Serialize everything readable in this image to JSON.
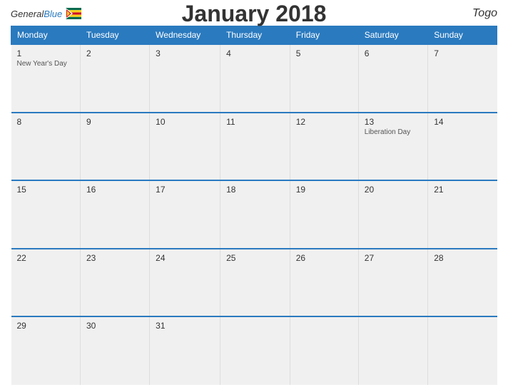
{
  "header": {
    "title": "January 2018",
    "country": "Togo",
    "logo": {
      "general": "General",
      "blue": "Blue"
    }
  },
  "weekdays": [
    "Monday",
    "Tuesday",
    "Wednesday",
    "Thursday",
    "Friday",
    "Saturday",
    "Sunday"
  ],
  "weeks": [
    [
      {
        "day": "1",
        "holiday": "New Year's Day"
      },
      {
        "day": "2",
        "holiday": ""
      },
      {
        "day": "3",
        "holiday": ""
      },
      {
        "day": "4",
        "holiday": ""
      },
      {
        "day": "5",
        "holiday": ""
      },
      {
        "day": "6",
        "holiday": ""
      },
      {
        "day": "7",
        "holiday": ""
      }
    ],
    [
      {
        "day": "8",
        "holiday": ""
      },
      {
        "day": "9",
        "holiday": ""
      },
      {
        "day": "10",
        "holiday": ""
      },
      {
        "day": "11",
        "holiday": ""
      },
      {
        "day": "12",
        "holiday": ""
      },
      {
        "day": "13",
        "holiday": "Liberation Day"
      },
      {
        "day": "14",
        "holiday": ""
      }
    ],
    [
      {
        "day": "15",
        "holiday": ""
      },
      {
        "day": "16",
        "holiday": ""
      },
      {
        "day": "17",
        "holiday": ""
      },
      {
        "day": "18",
        "holiday": ""
      },
      {
        "day": "19",
        "holiday": ""
      },
      {
        "day": "20",
        "holiday": ""
      },
      {
        "day": "21",
        "holiday": ""
      }
    ],
    [
      {
        "day": "22",
        "holiday": ""
      },
      {
        "day": "23",
        "holiday": ""
      },
      {
        "day": "24",
        "holiday": ""
      },
      {
        "day": "25",
        "holiday": ""
      },
      {
        "day": "26",
        "holiday": ""
      },
      {
        "day": "27",
        "holiday": ""
      },
      {
        "day": "28",
        "holiday": ""
      }
    ],
    [
      {
        "day": "29",
        "holiday": ""
      },
      {
        "day": "30",
        "holiday": ""
      },
      {
        "day": "31",
        "holiday": ""
      },
      {
        "day": "",
        "holiday": ""
      },
      {
        "day": "",
        "holiday": ""
      },
      {
        "day": "",
        "holiday": ""
      },
      {
        "day": "",
        "holiday": ""
      }
    ]
  ]
}
